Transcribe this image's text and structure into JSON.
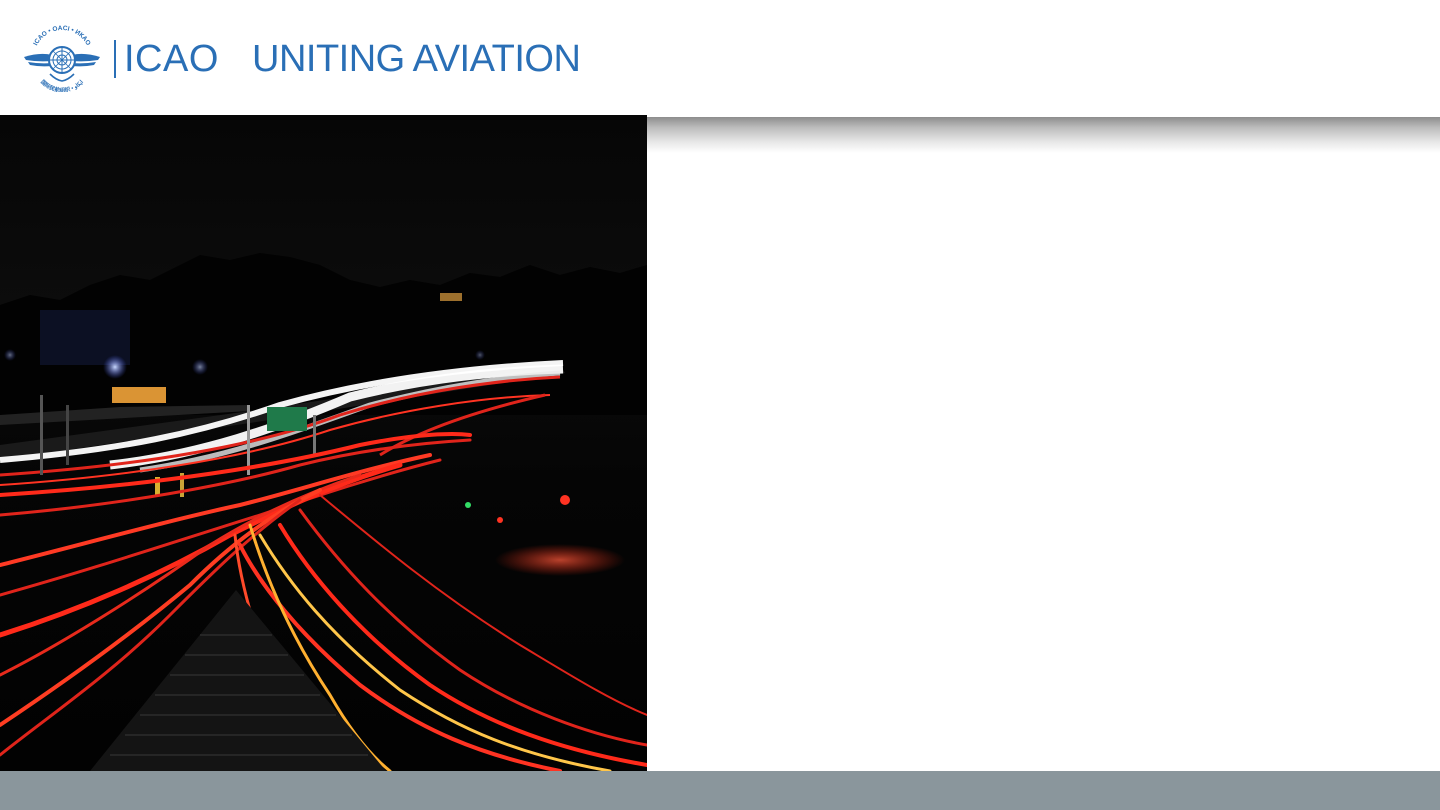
{
  "header": {
    "brand": "ICAO",
    "tagline": "UNITING AVIATION",
    "emblem_icon": "icao-emblem-icon",
    "emblem_text_top": "ICAO • OACI • ИКАО",
    "emblem_text_bottom": "国际民航组织 • ایکاو"
  },
  "hero": {
    "image": "night-highway-light-trails",
    "road_sign_icon": "highway-sign-icon"
  },
  "colors": {
    "brand_blue": "#2a6fb6",
    "footer_gray": "#8a969c",
    "trail_red": "#e0241b",
    "trail_white": "#f4f4f4",
    "trail_yellow": "#ffc64a"
  }
}
